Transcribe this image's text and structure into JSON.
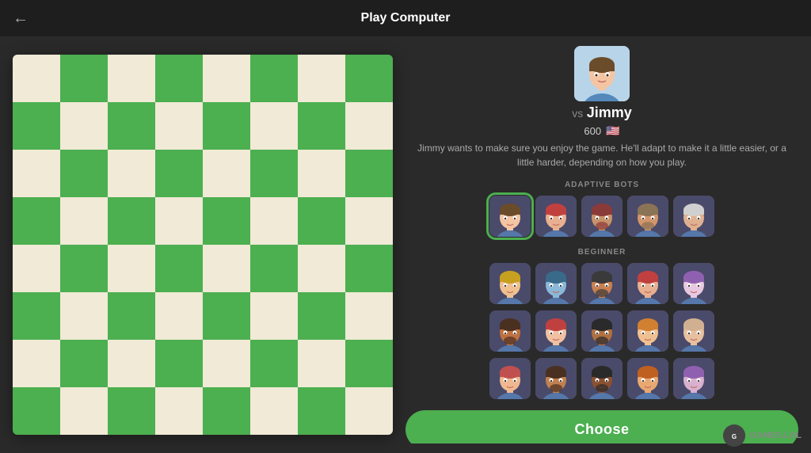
{
  "header": {
    "title": "Play Computer",
    "back_label": "←"
  },
  "profile": {
    "vs_prefix": "vs",
    "name": "Jimmy",
    "rating": "600",
    "flag": "🇺🇸",
    "description": "Jimmy wants to make sure you enjoy the game. He'll adapt to make it a little easier, or a little harder, depending on how you play."
  },
  "adaptive_label": "ADAPTIVE BOTS",
  "beginner_label": "BEGINNER",
  "choose_button": "Choose",
  "watermark": "GAMES.LOL",
  "board": {
    "size": 8
  },
  "adaptive_bots": [
    {
      "id": "a1",
      "selected": true,
      "hair": "#6b4c2a",
      "skin": "#f5c5a3"
    },
    {
      "id": "a2",
      "selected": false,
      "hair": "#c04040",
      "skin": "#e8b090"
    },
    {
      "id": "a3",
      "selected": false,
      "hair": "#8b3a3a",
      "skin": "#c8926a"
    },
    {
      "id": "a4",
      "selected": false,
      "hair": "#8b7355",
      "skin": "#d4956a"
    },
    {
      "id": "a5",
      "selected": false,
      "hair": "#d0d0d0",
      "skin": "#e0b090"
    }
  ],
  "beginner_bots_row1": [
    {
      "id": "b1",
      "hair": "#c8a020",
      "skin": "#f0c090"
    },
    {
      "id": "b2",
      "hair": "#3a6a8a",
      "skin": "#8ab8d8"
    },
    {
      "id": "b3",
      "hair": "#3a3a3a",
      "skin": "#c88050"
    },
    {
      "id": "b4",
      "hair": "#c04040",
      "skin": "#e8b090"
    },
    {
      "id": "b5",
      "hair": "#9060b0",
      "skin": "#e8c8e0"
    }
  ],
  "beginner_bots_row2": [
    {
      "id": "c1",
      "hair": "#4a3020",
      "skin": "#c07040"
    },
    {
      "id": "c2",
      "hair": "#c04040",
      "skin": "#f0c0a0"
    },
    {
      "id": "c3",
      "hair": "#2a2a2a",
      "skin": "#b07040"
    },
    {
      "id": "c4",
      "hair": "#d08030",
      "skin": "#f0c090"
    },
    {
      "id": "c5",
      "hair": "#d0b090",
      "skin": "#e8c0a0"
    }
  ],
  "beginner_bots_row3": [
    {
      "id": "d1",
      "hair": "#c05050",
      "skin": "#f0b890"
    },
    {
      "id": "d2",
      "hair": "#4a3020",
      "skin": "#c08050"
    },
    {
      "id": "d3",
      "hair": "#2a2a2a",
      "skin": "#8a5030"
    },
    {
      "id": "d4",
      "hair": "#c06020",
      "skin": "#e8a870"
    },
    {
      "id": "d5",
      "hair": "#9060b0",
      "skin": "#d8b0d0"
    }
  ]
}
